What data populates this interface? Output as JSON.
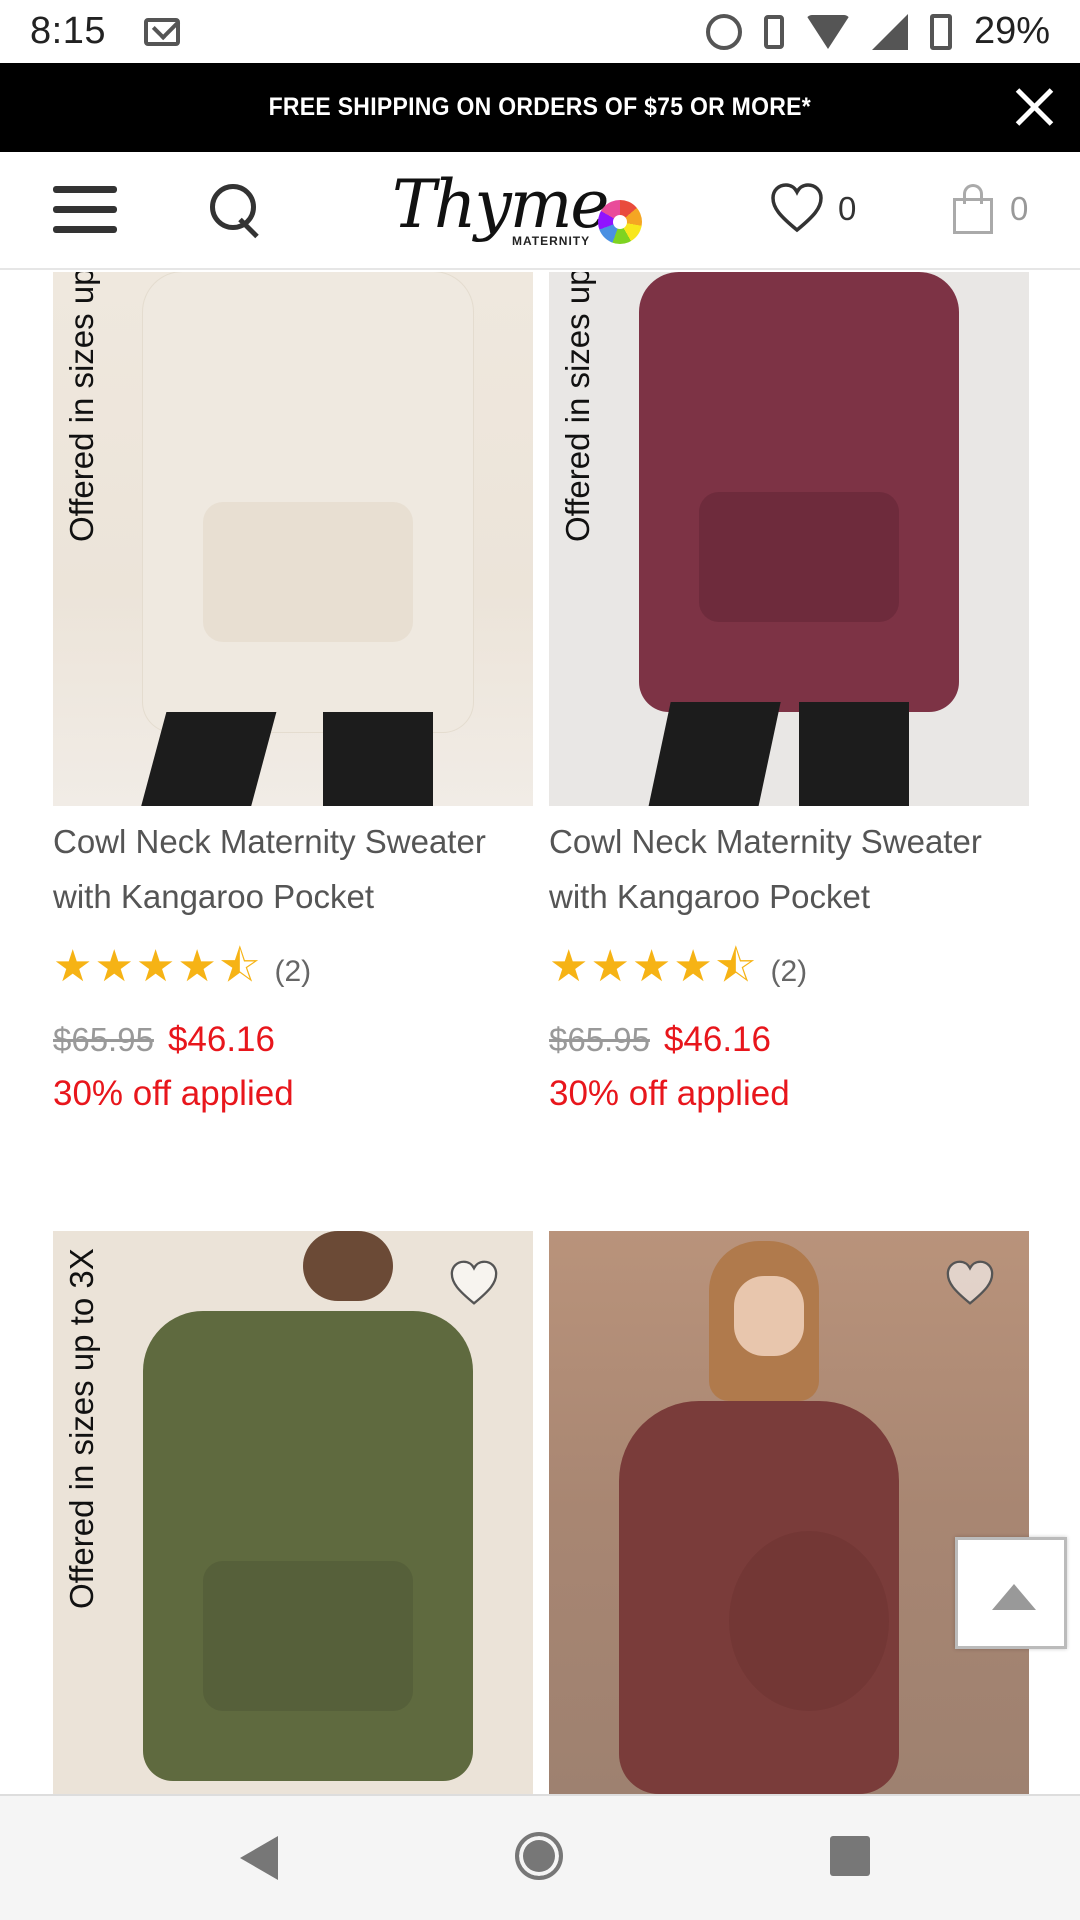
{
  "status_bar": {
    "time": "8:15",
    "battery_percent": "29%",
    "icons": [
      "mail-icon",
      "data-saver-icon",
      "vibrate-icon",
      "wifi-icon",
      "signal-icon",
      "battery-charging-icon"
    ]
  },
  "promo": {
    "text": "FREE SHIPPING ON ORDERS OF $75 OR MORE*",
    "close_icon": "close-icon"
  },
  "header": {
    "logo_script": "Thyme",
    "logo_sub": "MATERNITY",
    "wishlist_count": "0",
    "bag_count": "0"
  },
  "products": [
    {
      "label": "Offered in sizes up",
      "title_line1": "Cowl Neck Maternity Sweater",
      "title_line2": "with Kangaroo Pocket",
      "stars": "★★★★⯪",
      "rating_value": 4.5,
      "reviews": "(2)",
      "old_price": "$65.95",
      "new_price": "$46.16",
      "discount": "30% off applied"
    },
    {
      "label": "Offered in sizes up",
      "title_line1": "Cowl Neck Maternity Sweater",
      "title_line2": "with Kangaroo Pocket",
      "stars": "★★★★⯪",
      "rating_value": 4.5,
      "reviews": "(2)",
      "old_price": "$65.95",
      "new_price": "$46.16",
      "discount": "30% off applied"
    },
    {
      "label": "Offered in sizes up to 3X"
    },
    {
      "label": ""
    }
  ],
  "colors": {
    "sale_red": "#e8161c",
    "star_gold": "#f6b315",
    "promo_bg": "#000000"
  }
}
